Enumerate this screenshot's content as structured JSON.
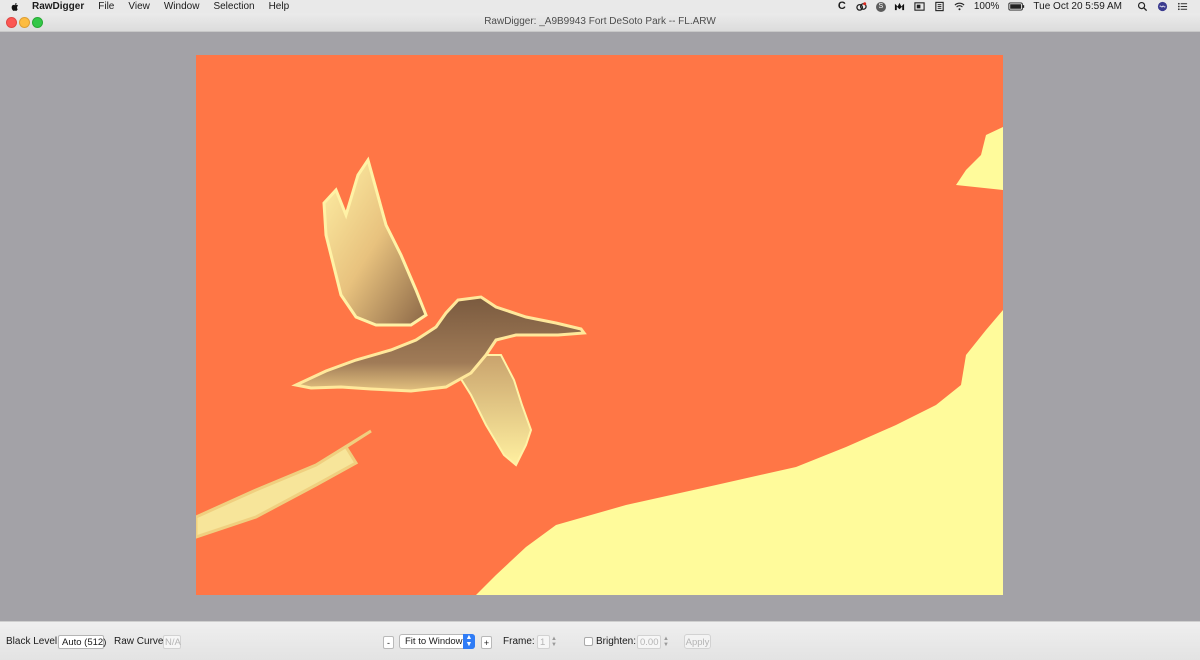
{
  "menubar": {
    "app_name": "RawDigger",
    "items": [
      "File",
      "View",
      "Window",
      "Selection",
      "Help"
    ],
    "tray": {
      "c_label": "C",
      "s_label": "S",
      "battery": "100%",
      "clock": "Tue Oct 20  5:59 AM"
    }
  },
  "window": {
    "title": "RawDigger: _A9B9943 Fort DeSoto Park -- FL.ARW"
  },
  "image": {
    "colors": {
      "sky": "#ff7646",
      "cloud": "#fffb9b",
      "bird_light": "#f6df8e",
      "bird_dark": "#79593f",
      "canvas": "#a3a2a7"
    }
  },
  "toolbar": {
    "black_level_label": "Black Level:",
    "black_level_value": "Auto (512)",
    "raw_curve_label": "Raw Curve:",
    "raw_curve_value": "N/A",
    "zoom_minus": "-",
    "zoom_mode": "Fit to Window",
    "zoom_plus": "+",
    "frame_label": "Frame:",
    "frame_value": "1",
    "brighten_label": "Brighten:",
    "brighten_value": "0.00",
    "apply_label": "Apply"
  }
}
